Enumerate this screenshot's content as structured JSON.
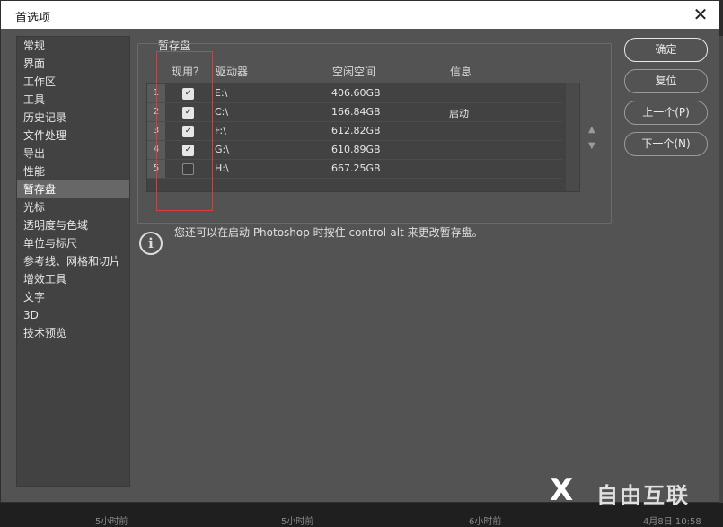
{
  "window": {
    "title": "首选项",
    "close_label": "✕"
  },
  "sidebar": {
    "items": [
      {
        "label": "常规"
      },
      {
        "label": "界面"
      },
      {
        "label": "工作区"
      },
      {
        "label": "工具"
      },
      {
        "label": "历史记录"
      },
      {
        "label": "文件处理"
      },
      {
        "label": "导出"
      },
      {
        "label": "性能"
      },
      {
        "label": "暂存盘"
      },
      {
        "label": "光标"
      },
      {
        "label": "透明度与色域"
      },
      {
        "label": "单位与标尺"
      },
      {
        "label": "参考线、网格和切片"
      },
      {
        "label": "增效工具"
      },
      {
        "label": "文字"
      },
      {
        "label": "3D"
      },
      {
        "label": "技术预览"
      }
    ],
    "active_index": 8
  },
  "scratch": {
    "title": "暂存盘",
    "columns": {
      "active": "现用？",
      "drive": "驱动器",
      "free": "空闲空间",
      "info": "信息"
    },
    "rows": [
      {
        "num": "1",
        "checked": true,
        "drive": "E:\\",
        "free": "406.60GB",
        "info": ""
      },
      {
        "num": "2",
        "checked": true,
        "drive": "C:\\",
        "free": "166.84GB",
        "info": "启动"
      },
      {
        "num": "3",
        "checked": true,
        "drive": "F:\\",
        "free": "612.82GB",
        "info": ""
      },
      {
        "num": "4",
        "checked": true,
        "drive": "G:\\",
        "free": "610.89GB",
        "info": ""
      },
      {
        "num": "5",
        "checked": false,
        "drive": "H:\\",
        "free": "667.25GB",
        "info": ""
      }
    ],
    "move_up": "▲",
    "move_down": "▼"
  },
  "note": "您还可以在启动 Photoshop 时按住 control-alt 来更改暂存盘。",
  "info_icon": "i",
  "buttons": {
    "ok": "确定",
    "reset": "复位",
    "prev": "上一个(P)",
    "next": "下一个(N)"
  },
  "backdrop": {
    "t1": "5小时前",
    "t2": "5小时前",
    "t3": "6小时前",
    "t4": "4月8日 10:58"
  },
  "watermark": {
    "mark": "X",
    "text": "自由互联"
  },
  "colors": {
    "dialog_bg": "#535353",
    "sidebar_bg": "#424242",
    "highlight": "#e03a3a",
    "active_item": "#676767"
  }
}
